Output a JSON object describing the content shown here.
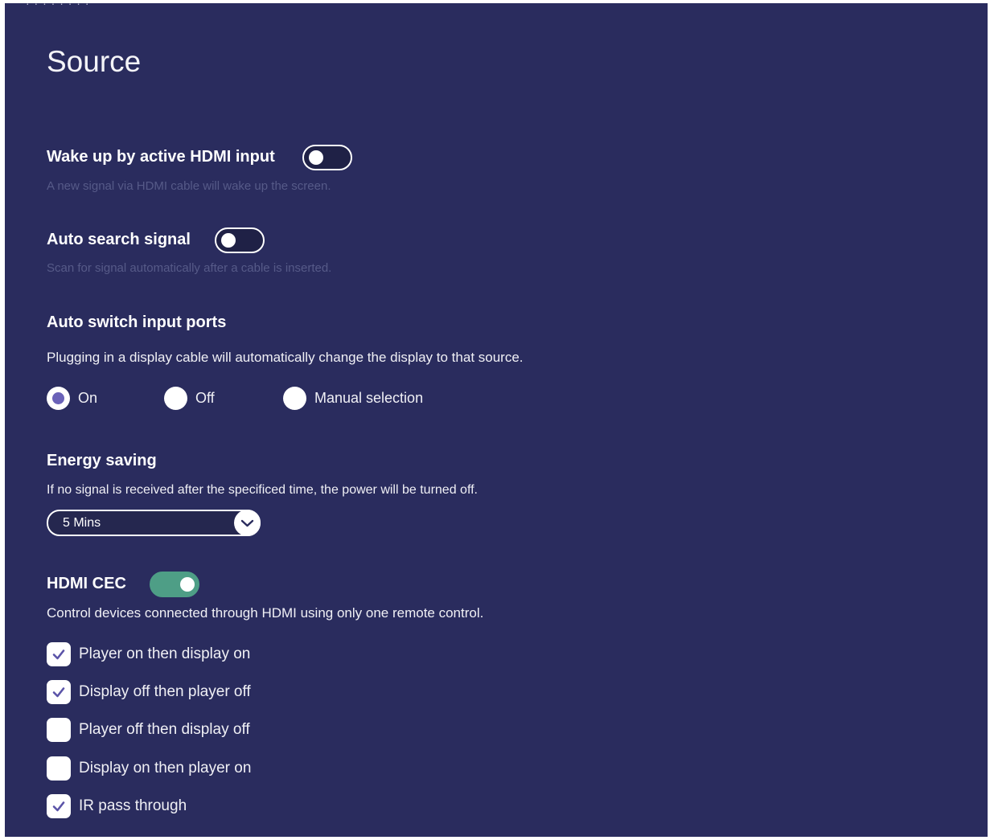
{
  "page": {
    "title": "Source",
    "top_fragment": "· ·  · · · · · ·"
  },
  "wake_hdmi": {
    "label": "Wake up by active HDMI input",
    "hint": "A new signal via HDMI cable will wake up the screen.",
    "enabled": false
  },
  "auto_search": {
    "label": "Auto search signal",
    "hint": "Scan for signal automatically after a cable is inserted.",
    "enabled": false
  },
  "auto_switch": {
    "label": "Auto switch input ports",
    "description": "Plugging in a display cable will automatically change the display to that source.",
    "options": [
      "On",
      "Off",
      "Manual selection"
    ],
    "selected": "On"
  },
  "energy_saving": {
    "label": "Energy saving",
    "description": "If no signal is received after the specificed time, the power will be turned off.",
    "value": "5 Mins"
  },
  "hdmi_cec": {
    "label": "HDMI CEC",
    "enabled": true,
    "description": "Control devices connected through HDMI using only one remote control.",
    "options": [
      {
        "label": "Player on then display on",
        "checked": true
      },
      {
        "label": "Display off then player off",
        "checked": true
      },
      {
        "label": "Player off then display off",
        "checked": false
      },
      {
        "label": "Display on then player on",
        "checked": false
      },
      {
        "label": "IR pass through",
        "checked": true
      }
    ]
  },
  "colors": {
    "background": "#2a2c5e",
    "toggle_on": "#4e9e86",
    "radio_accent": "#6a62b8",
    "check_accent": "#5b54a8",
    "hint_text": "#565a88"
  }
}
